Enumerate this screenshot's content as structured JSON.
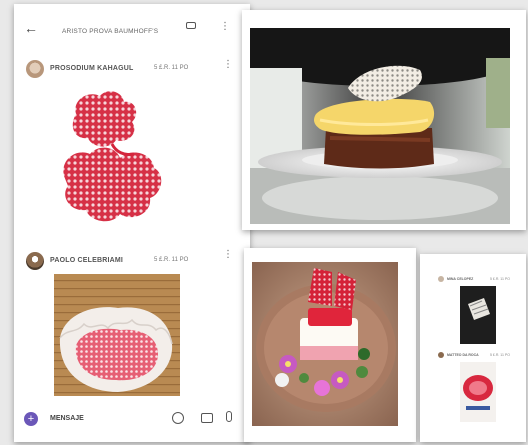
{
  "chat": {
    "header_title": "ARISTO PROVA BAUMHOFF'S",
    "back_icon": "arrow-left-icon",
    "messages": [
      {
        "sender": "PROSODIUM KAHAGUL",
        "time": "5 £.R. 11 PO",
        "image": "red-sugar-lace-on-white"
      },
      {
        "sender": "PAOLO CELEBRIAMI",
        "time": "5 £.R. 11 PO",
        "image": "red-sugar-lace-in-paper-cup"
      }
    ],
    "composer": {
      "value": "MENSAJE"
    }
  },
  "mini_chat": {
    "messages": [
      {
        "sender": "MINA CELOPEZ",
        "time": "5 £.R. 11 PO"
      },
      {
        "sender": "MATTEO DA ROCA",
        "time": "5 £.R. 11 PO"
      }
    ]
  },
  "photos": {
    "top": "layered-dessert-with-sugar-tuile",
    "bottom": "strawberry-cake-with-edible-flowers"
  }
}
